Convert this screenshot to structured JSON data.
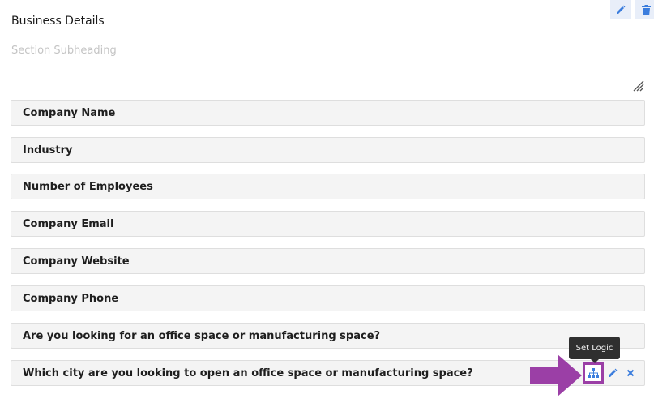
{
  "section": {
    "title": "Business Details",
    "subheading": "Section Subheading"
  },
  "fields": [
    {
      "label": "Company Name"
    },
    {
      "label": "Industry"
    },
    {
      "label": "Number of Employees"
    },
    {
      "label": "Company Email"
    },
    {
      "label": "Company Website"
    },
    {
      "label": "Company Phone"
    },
    {
      "label": "Are you looking for an office space or manufacturing space?"
    },
    {
      "label": "Which city are you looking to open an office space or manufacturing space?"
    }
  ],
  "tooltip": {
    "text": "Set Logic"
  },
  "icons": {
    "header_edit": "pencil-icon",
    "header_delete": "trash-icon",
    "row_logic": "sitemap-icon",
    "row_edit": "pencil-icon",
    "row_remove": "close-icon",
    "annotation": "arrow-right-icon"
  },
  "colors": {
    "accent_blue": "#3b7ddd",
    "highlight_purple": "#9b3fa6",
    "row_background": "#f4f4f4"
  }
}
